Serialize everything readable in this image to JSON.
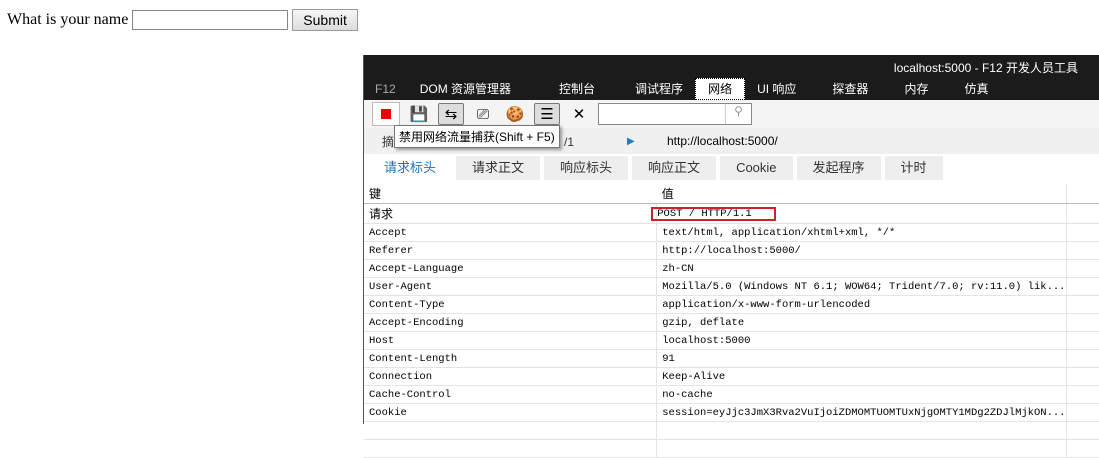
{
  "form": {
    "label": "What is your name",
    "value": "",
    "submit": "Submit"
  },
  "devtools": {
    "title": "localhost:5000 - F12 开发人员工具",
    "tabs": [
      "F12",
      "DOM 资源管理器",
      "控制台",
      "调试程序",
      "网络",
      "UI 响应",
      "探查器",
      "内存",
      "仿真"
    ],
    "active_tab": "网络",
    "tooltip": "禁用网络流量捕获(Shift + F5)",
    "crumb_left": "摘",
    "crumb_left_suffix": "/1",
    "url": "http://localhost:5000/",
    "subtabs": [
      "请求标头",
      "请求正文",
      "响应标头",
      "响应正文",
      "Cookie",
      "发起程序",
      "计时"
    ],
    "columns": {
      "key": "键",
      "value": "值"
    },
    "rows": [
      {
        "k": "请求",
        "v": "POST / HTTP/1.1"
      },
      {
        "k": "Accept",
        "v": "text/html, application/xhtml+xml, */*"
      },
      {
        "k": "Referer",
        "v": "http://localhost:5000/"
      },
      {
        "k": "Accept-Language",
        "v": "zh-CN"
      },
      {
        "k": "User-Agent",
        "v": "Mozilla/5.0 (Windows NT 6.1; WOW64; Trident/7.0; rv:11.0) lik..."
      },
      {
        "k": "Content-Type",
        "v": "application/x-www-form-urlencoded"
      },
      {
        "k": "Accept-Encoding",
        "v": "gzip, deflate"
      },
      {
        "k": "Host",
        "v": "localhost:5000"
      },
      {
        "k": "Content-Length",
        "v": "91"
      },
      {
        "k": "Connection",
        "v": "Keep-Alive"
      },
      {
        "k": "Cache-Control",
        "v": "no-cache"
      },
      {
        "k": "Cookie",
        "v": "session=eyJjc3JmX3Rva2VuIjoiZDMOMTUOMTUxNjgOMTY1MDg2ZDJlMjkON..."
      }
    ]
  }
}
